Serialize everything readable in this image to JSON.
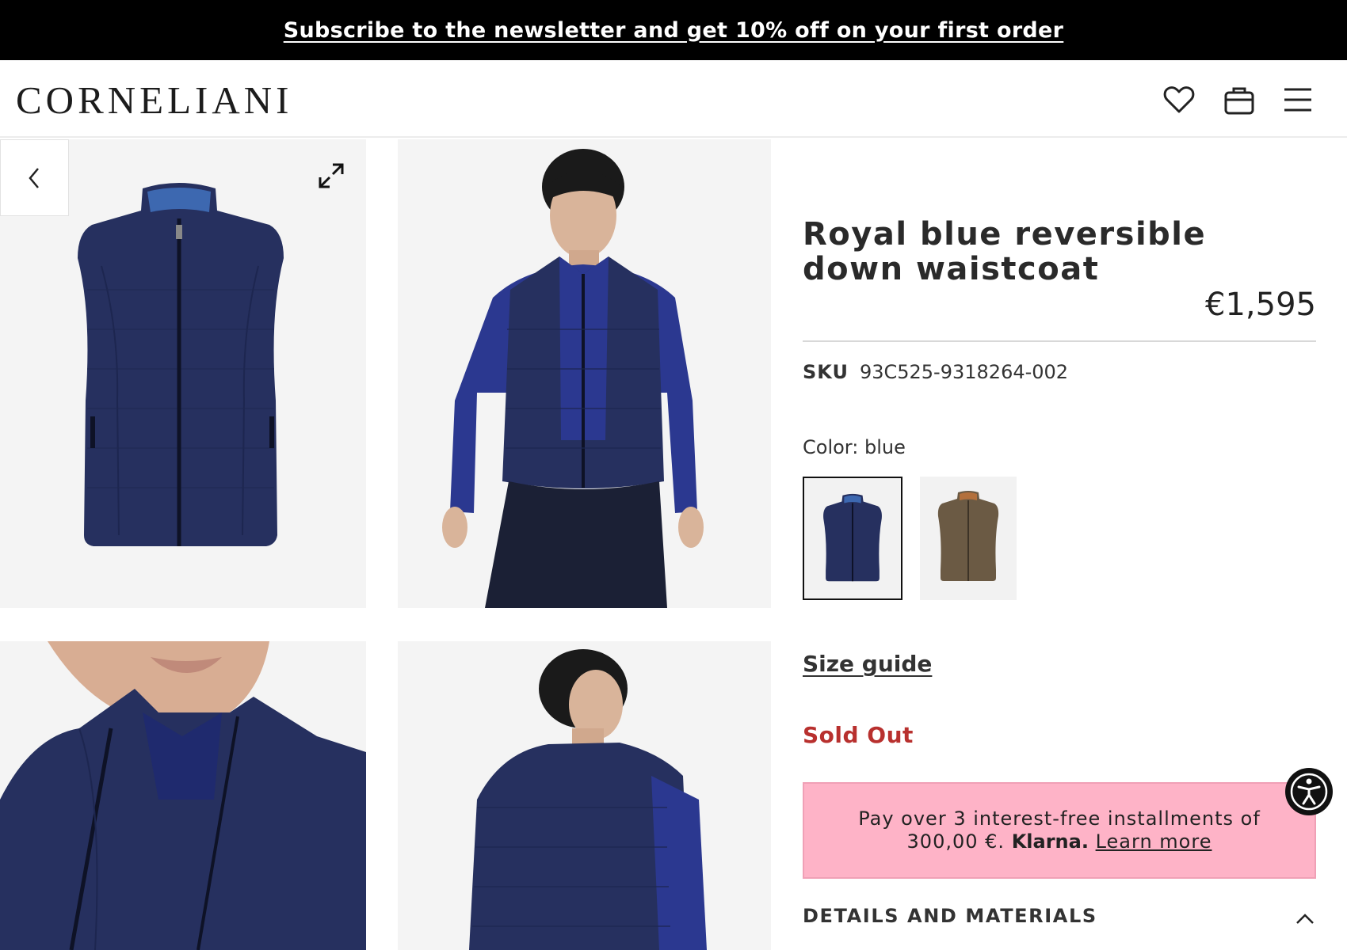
{
  "promo": {
    "text": "Subscribe to the newsletter and get 10% off on your first order"
  },
  "header": {
    "logo": "CORNELIANI",
    "icons": [
      "heart-icon",
      "bag-icon",
      "menu-icon"
    ]
  },
  "gallery": {
    "icons": [
      "chevron-left-icon",
      "expand-icon"
    ],
    "images": [
      "waistcoat-front",
      "model-front",
      "collar-detail",
      "model-back"
    ]
  },
  "product": {
    "title": "Royal blue reversible down waistcoat",
    "price": "€1,595",
    "sku_label": "SKU",
    "sku_value": "93C525-9318264-002",
    "color_label": "Color: blue",
    "swatches": [
      {
        "color": "#26305f",
        "selected": true
      },
      {
        "color": "#6b5a44",
        "selected": false
      }
    ],
    "size_guide": "Size guide",
    "status": "Sold Out",
    "klarna": {
      "text": "Pay over 3 interest-free installments of 300,00 €.",
      "brand": "Klarna.",
      "link": "Learn more"
    },
    "details_label": "DETAILS AND MATERIALS"
  },
  "colors": {
    "promo_bg": "#000000",
    "sold_out": "#b8302e",
    "klarna_bg": "#feb3c7",
    "vest_navy": "#26305f"
  }
}
